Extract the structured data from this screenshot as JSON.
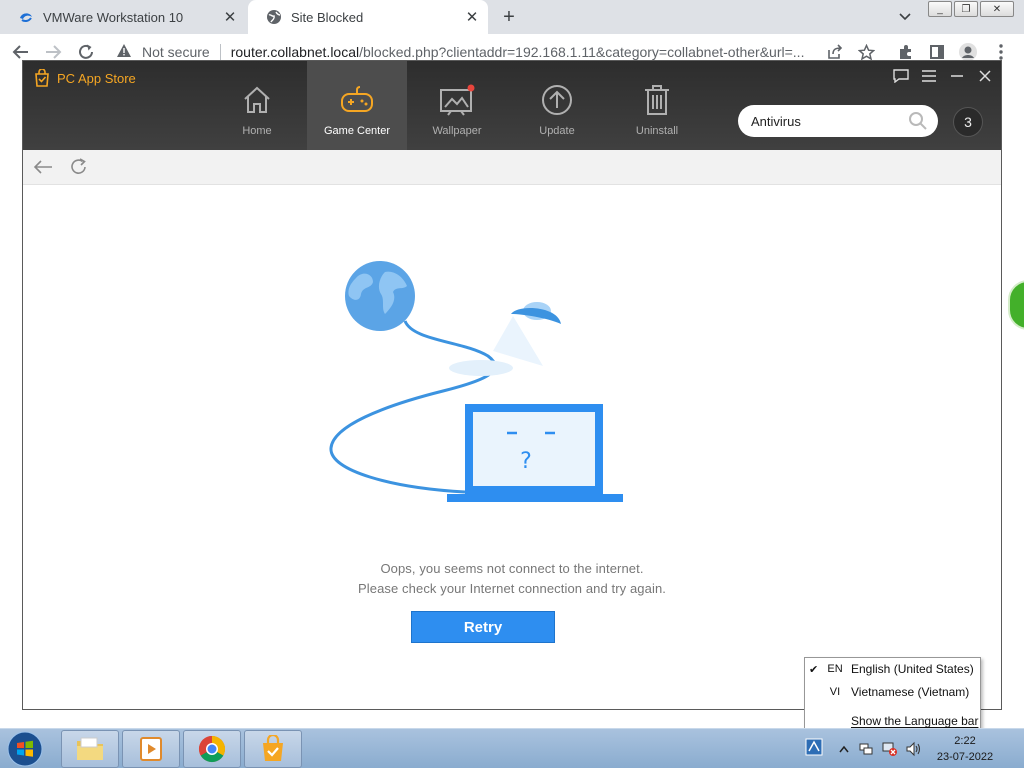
{
  "browser": {
    "tabs": [
      {
        "title": "VMWare Workstation 10",
        "active": false
      },
      {
        "title": "Site Blocked",
        "active": true
      }
    ],
    "new_tab_symbol": "+",
    "window_controls": [
      "_",
      "❐",
      "✕"
    ],
    "address": {
      "security_label": "Not secure",
      "host": "router.collabnet.local",
      "path": "/blocked.php?clientaddr=192.168.1.11&category=collabnet-other&url=..."
    }
  },
  "app": {
    "name": "PC App Store",
    "nav": [
      {
        "label": "Home",
        "icon": "home-icon",
        "active": false
      },
      {
        "label": "Game Center",
        "icon": "gamepad-icon",
        "active": true
      },
      {
        "label": "Wallpaper",
        "icon": "wallpaper-icon",
        "active": false
      },
      {
        "label": "Update",
        "icon": "upload-arrow-icon",
        "active": false
      },
      {
        "label": "Uninstall",
        "icon": "trash-icon",
        "active": false
      }
    ],
    "search": {
      "value": "Antivirus"
    },
    "badge_count": "3",
    "error": {
      "line1": "Oops, you seems not connect to the internet.",
      "line2": "Please check your Internet connection and try again.",
      "retry_label": "Retry"
    },
    "accent_color": "#2e8ef0",
    "brand_color": "#f5a623"
  },
  "language_menu": {
    "items": [
      {
        "code": "EN",
        "name": "English (United States)",
        "checked": true
      },
      {
        "code": "VI",
        "name": "Vietnamese (Vietnam)",
        "checked": false
      }
    ],
    "show_bar_label": "Show the Language bar"
  },
  "taskbar": {
    "clock_time": "2:22",
    "clock_date": "23-07-2022"
  }
}
